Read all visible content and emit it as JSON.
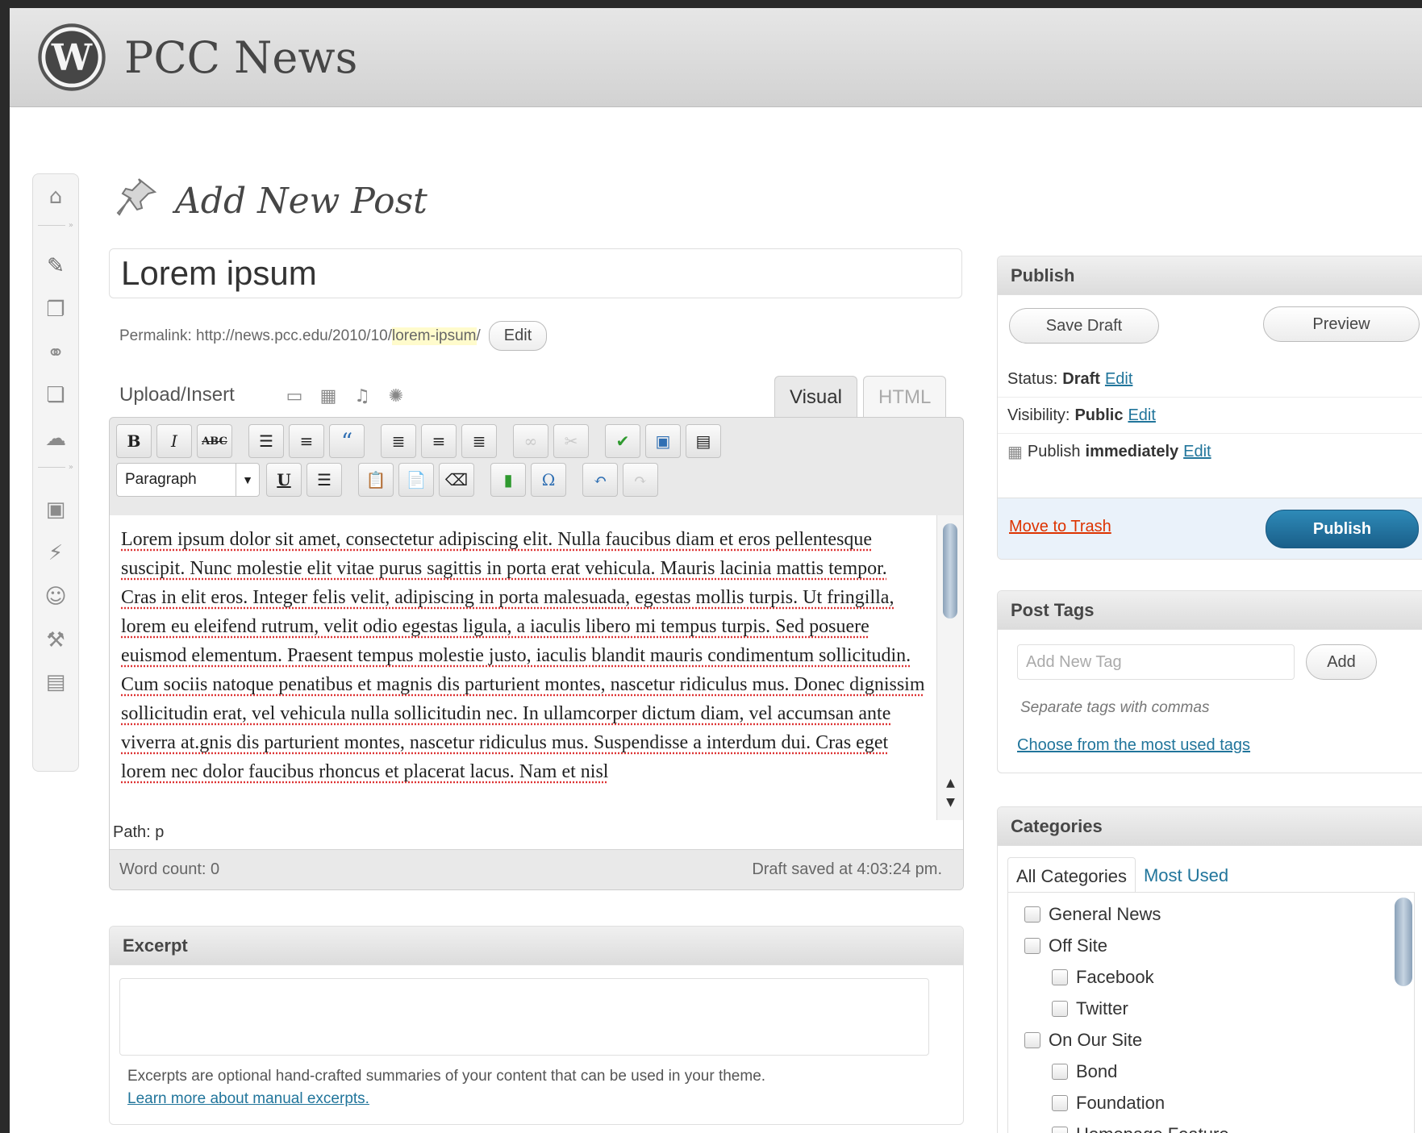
{
  "header": {
    "site_title": "PCC News"
  },
  "admin_menu": {
    "icons": [
      "dashboard-icon",
      "posts-icon",
      "media-icon",
      "links-icon",
      "pages-icon",
      "comments-icon",
      "appearance-icon",
      "plugins-icon",
      "users-icon",
      "tools-icon",
      "settings-icon"
    ]
  },
  "page": {
    "title": "Add New Post"
  },
  "post": {
    "title": "Lorem ipsum",
    "permalink_label": "Permalink:",
    "permalink_base": "http://news.pcc.edu/2010/10/",
    "permalink_slug": "lorem-ipsum",
    "permalink_trailing": "/",
    "permalink_edit": "Edit"
  },
  "editor": {
    "upload_insert": "Upload/Insert",
    "tab_visual": "Visual",
    "tab_html": "HTML",
    "format_select": "Paragraph",
    "content": "Lorem ipsum dolor sit amet, consectetur adipiscing elit. Nulla faucibus diam et eros pellentesque suscipit. Nunc molestie elit vitae purus sagittis in porta erat vehicula. Mauris lacinia mattis tempor. Cras in elit eros. Integer felis velit, adipiscing in porta malesuada, egestas mollis turpis. Ut fringilla, lorem eu eleifend rutrum, velit odio egestas ligula, a iaculis libero mi tempus turpis. Sed posuere euismod elementum. Praesent tempus molestie justo, iaculis blandit mauris condimentum sollicitudin. Cum sociis natoque penatibus et magnis dis parturient montes, nascetur ridiculus mus. Donec dignissim sollicitudin erat, vel vehicula nulla sollicitudin nec. In ullamcorper dictum diam, vel accumsan ante viverra at.gnis dis parturient montes, nascetur ridiculus mus. Suspendisse a interdum dui. Cras eget lorem nec dolor faucibus rhoncus et placerat lacus. Nam et nisl",
    "path": "Path: p",
    "word_count": "Word count: 0",
    "draft_saved": "Draft saved at 4:03:24 pm."
  },
  "excerpt": {
    "heading": "Excerpt",
    "help": "Excerpts are optional hand-crafted summaries of your content that can be used in your theme.",
    "learn_more": "Learn more about manual excerpts."
  },
  "publish": {
    "heading": "Publish",
    "save_draft": "Save Draft",
    "preview": "Preview",
    "status_label": "Status:",
    "status_value": "Draft",
    "visibility_label": "Visibility:",
    "visibility_value": "Public",
    "publish_label": "Publish",
    "publish_value": "immediately",
    "edit": "Edit",
    "move_to_trash": "Move to Trash",
    "publish_button": "Publish"
  },
  "tags": {
    "heading": "Post Tags",
    "placeholder": "Add New Tag",
    "add": "Add",
    "help": "Separate tags with commas",
    "choose_link": "Choose from the most used tags"
  },
  "categories": {
    "heading": "Categories",
    "tab_all": "All Categories",
    "tab_most_used": "Most Used",
    "items": [
      {
        "label": "General News",
        "level": 0,
        "checked": false
      },
      {
        "label": "Off Site",
        "level": 0,
        "checked": false
      },
      {
        "label": "Facebook",
        "level": 1,
        "checked": false
      },
      {
        "label": "Twitter",
        "level": 1,
        "checked": false
      },
      {
        "label": "On Our Site",
        "level": 0,
        "checked": false
      },
      {
        "label": "Bond",
        "level": 1,
        "checked": false
      },
      {
        "label": "Foundation",
        "level": 1,
        "checked": false
      },
      {
        "label": "Homepage Feature",
        "level": 1,
        "checked": false
      }
    ]
  }
}
